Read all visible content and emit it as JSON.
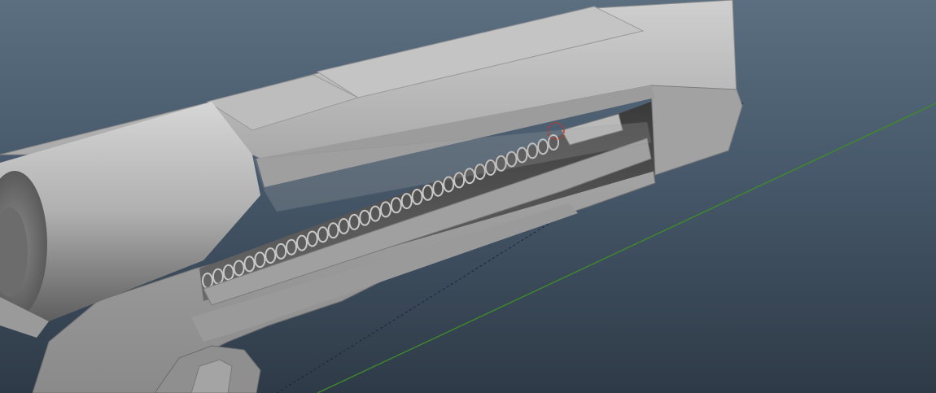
{
  "viewport": {
    "background_top": "#5b6f80",
    "background_bottom": "#2e3a47",
    "grid_axis_x_color": "#3f8a2a",
    "grid_axis_z_color": "#1a1f3a"
  },
  "scene": {
    "model": "pistol-slide-mesh",
    "shading": "smooth-shaded-gray",
    "mesh_color": "#b5b5b5",
    "selection_marker_color": "#c0392b"
  }
}
